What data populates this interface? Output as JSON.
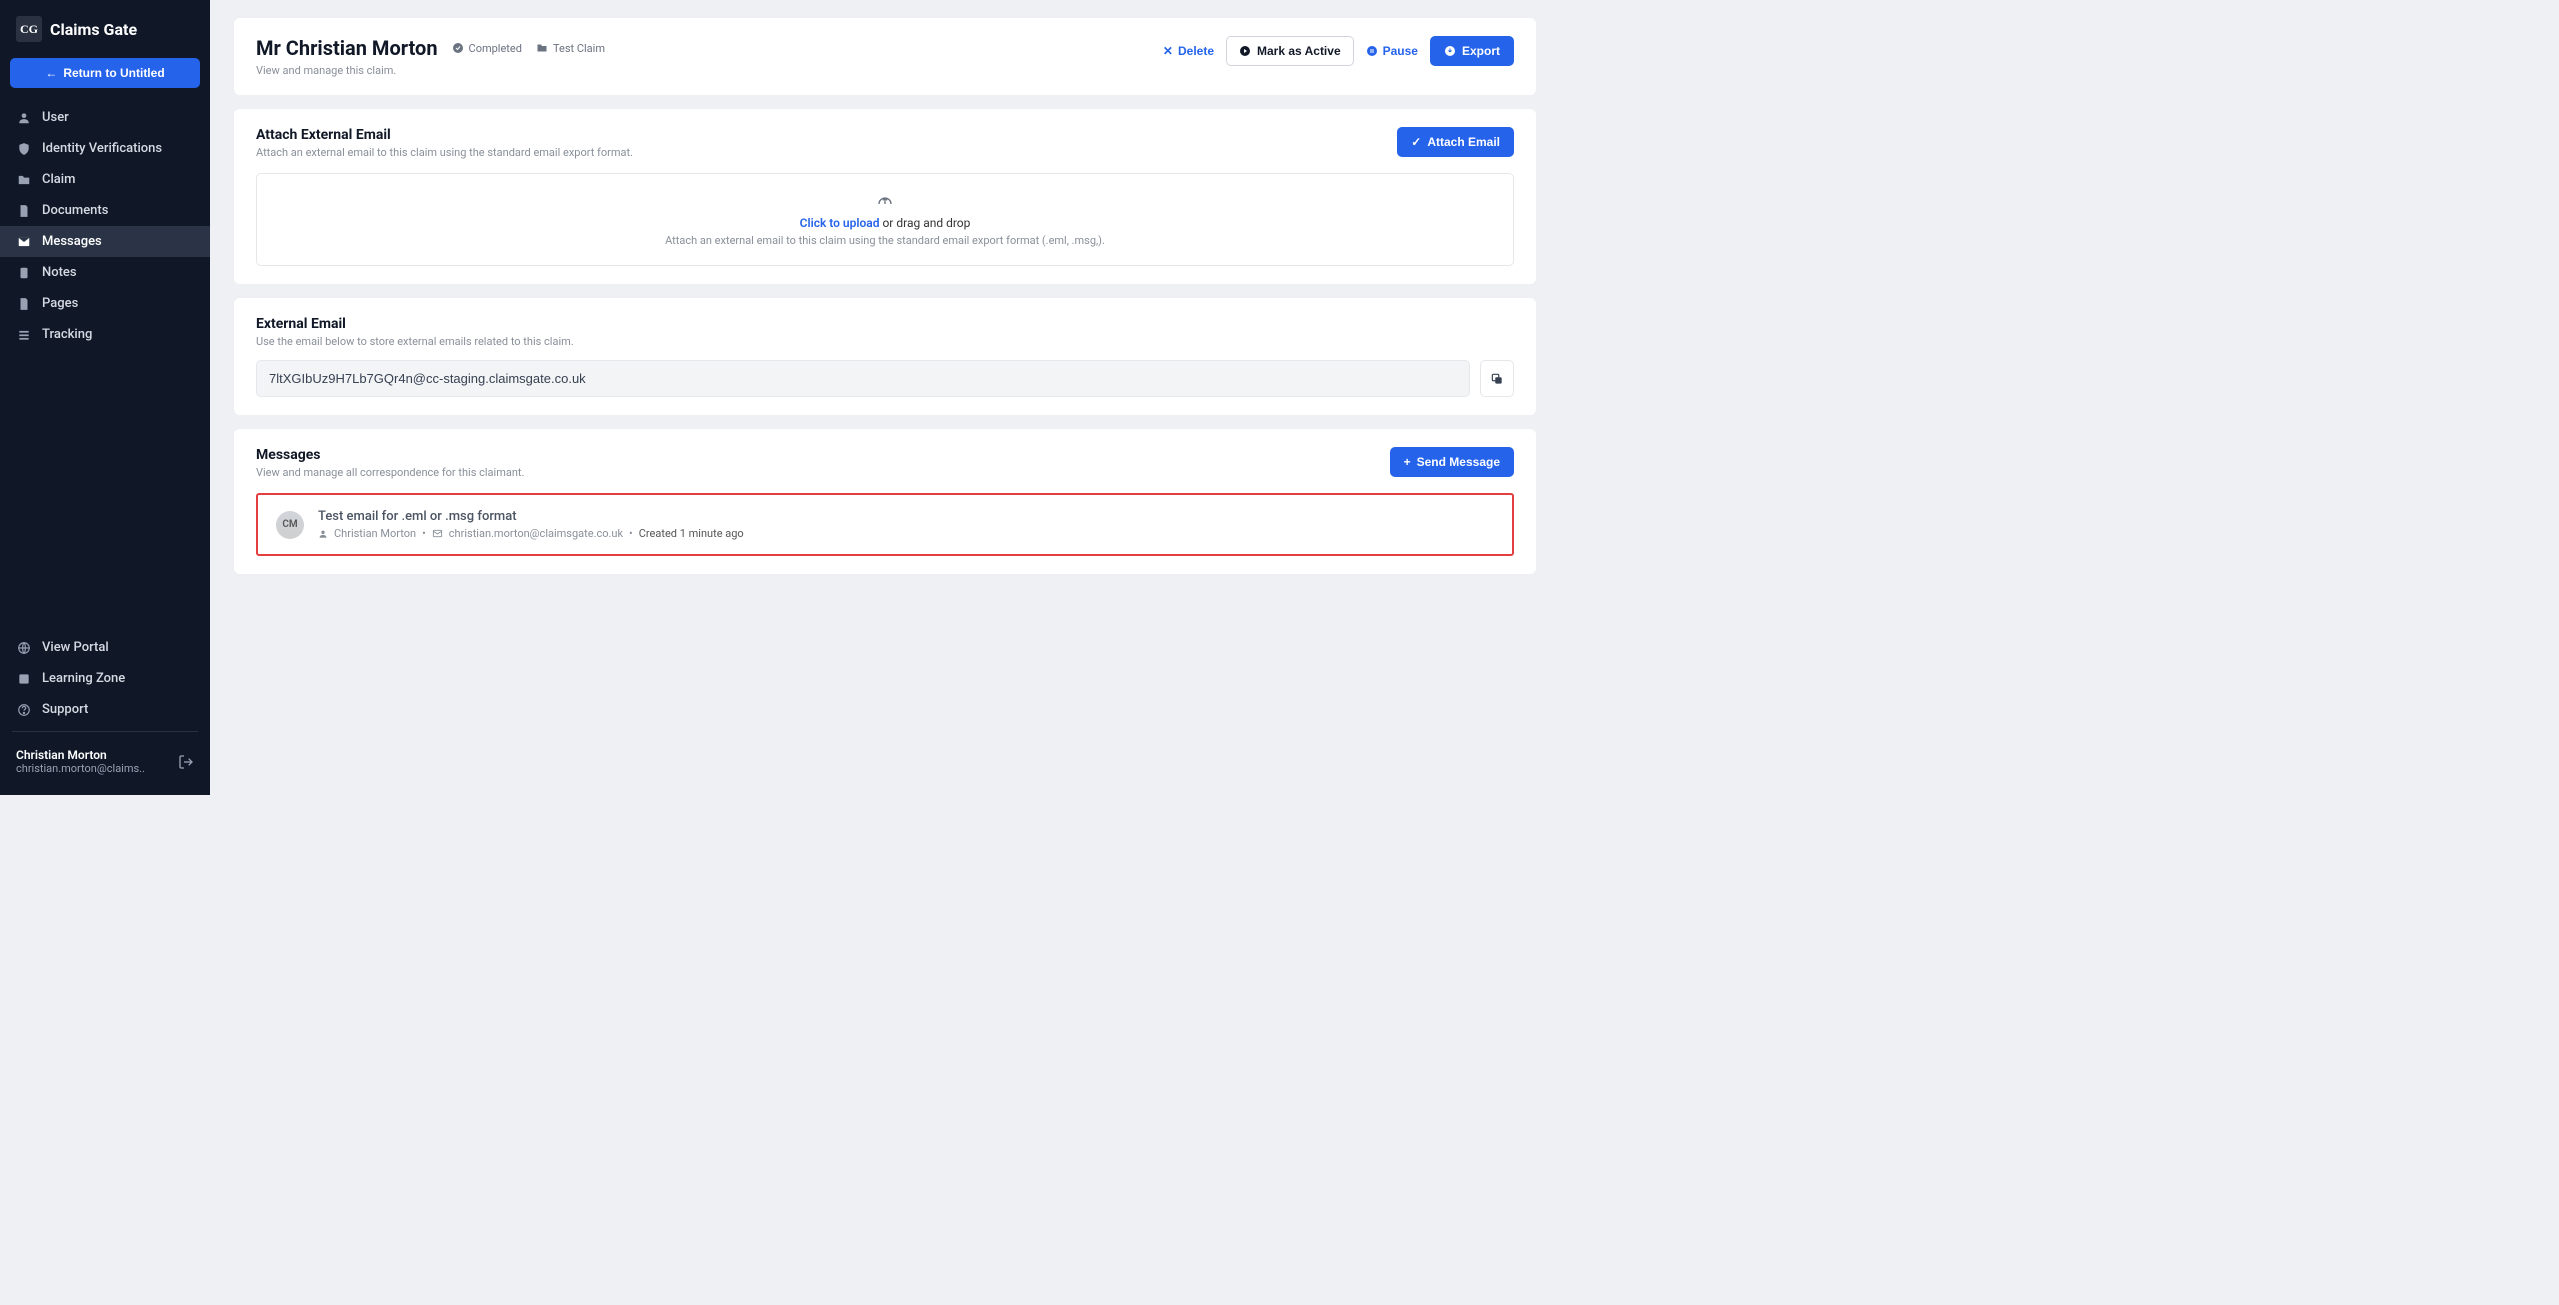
{
  "brand": {
    "name": "Claims Gate",
    "mark": "CG"
  },
  "sidebar": {
    "return_label": "Return to Untitled",
    "items": [
      {
        "label": "User"
      },
      {
        "label": "Identity Verifications"
      },
      {
        "label": "Claim"
      },
      {
        "label": "Documents"
      },
      {
        "label": "Messages"
      },
      {
        "label": "Notes"
      },
      {
        "label": "Pages"
      },
      {
        "label": "Tracking"
      }
    ],
    "bottom": [
      {
        "label": "View Portal"
      },
      {
        "label": "Learning Zone"
      },
      {
        "label": "Support"
      }
    ],
    "user": {
      "name": "Christian Morton",
      "email": "christian.morton@claims.."
    }
  },
  "header": {
    "title": "Mr Christian Morton",
    "status": "Completed",
    "tag": "Test Claim",
    "subtitle": "View and manage this claim.",
    "actions": {
      "delete": "Delete",
      "mark_active": "Mark as Active",
      "pause": "Pause",
      "export": "Export"
    }
  },
  "attach": {
    "title": "Attach External Email",
    "sub": "Attach an external email to this claim using the standard email export format.",
    "button": "Attach Email",
    "dz_link": "Click to upload",
    "dz_rest": " or drag and drop",
    "dz_sub": "Attach an external email to this claim using the standard email export format (.eml, .msg,)."
  },
  "external": {
    "title": "External Email",
    "sub": "Use the email below to store external emails related to this claim.",
    "value": "7ltXGIbUz9H7Lb7GQr4n@cc-staging.claimsgate.co.uk"
  },
  "messages": {
    "title": "Messages",
    "sub": "View and manage all correspondence for this claimant.",
    "send": "Send Message",
    "item": {
      "initials": "CM",
      "subject": "Test email for .eml or .msg format",
      "author": "Christian Morton",
      "from": "christian.morton@claimsgate.co.uk",
      "created": "Created 1 minute ago"
    }
  }
}
